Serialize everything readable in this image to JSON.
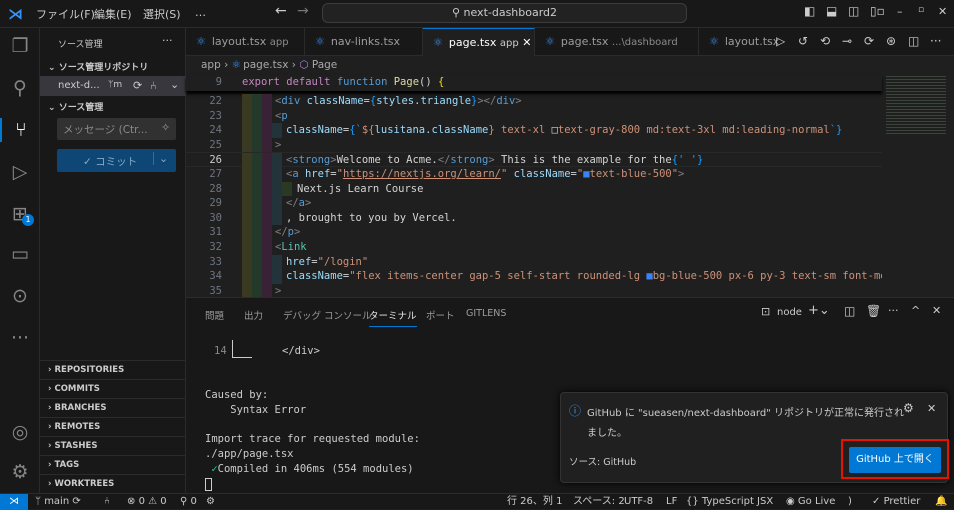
{
  "titlebar": {
    "menus": [
      "ファイル(F)",
      "編集(E)",
      "選択(S)",
      "…"
    ],
    "search": "next-dashboard2"
  },
  "activity": {
    "extensions_badge": "1"
  },
  "sidebar": {
    "title": "ソース管理",
    "repos_header": "ソース管理リポジトリ",
    "repo_name": "next-d...",
    "repo_branch_icon": "ᛘm",
    "sc_header": "ソース管理",
    "message_placeholder": "メッセージ (Ctr...",
    "commit_label": "✓ コミット",
    "sections": [
      "REPOSITORIES",
      "COMMITS",
      "BRANCHES",
      "REMOTES",
      "STASHES",
      "TAGS",
      "WORKTREES"
    ]
  },
  "tabs": [
    {
      "name": "layout.tsx",
      "desc": "app"
    },
    {
      "name": "nav-links.tsx",
      "desc": ""
    },
    {
      "name": "page.tsx",
      "desc": "app",
      "active": true
    },
    {
      "name": "page.tsx",
      "desc": "...\\dashboard"
    },
    {
      "name": "layout.tsx",
      "desc": ""
    }
  ],
  "breadcrumb": [
    "app",
    "page.tsx",
    "Page"
  ],
  "sticky": {
    "num": "9",
    "tokens": [
      [
        "export default ",
        "k"
      ],
      [
        "function ",
        "f"
      ],
      [
        "Page",
        "y"
      ],
      [
        "() ",
        "w"
      ],
      [
        "{",
        "b"
      ]
    ]
  },
  "code": [
    {
      "num": "22",
      "indent": 3,
      "tokens": [
        [
          "<",
          "g"
        ],
        [
          "div ",
          "t"
        ],
        [
          "className",
          "a"
        ],
        [
          "=",
          "w"
        ],
        [
          "{",
          "p"
        ],
        [
          "styles.triangle",
          "v"
        ],
        [
          "}",
          "p"
        ],
        [
          "></",
          "g"
        ],
        [
          "div",
          "t"
        ],
        [
          ">",
          "g"
        ]
      ]
    },
    {
      "num": "23",
      "indent": 3,
      "tokens": [
        [
          "<",
          "g"
        ],
        [
          "p",
          "t"
        ]
      ]
    },
    {
      "num": "24",
      "indent": 4,
      "tokens": [
        [
          "className",
          "a"
        ],
        [
          "=",
          "w"
        ],
        [
          "{`",
          "p"
        ],
        [
          "${",
          "s"
        ],
        [
          "lusitana.className",
          "v"
        ],
        [
          "}",
          "s"
        ],
        [
          " text-xl ",
          "s"
        ],
        [
          "□",
          "w"
        ],
        [
          "text-gray-800 md:text-3xl md:leading-normal",
          "s"
        ],
        [
          "`}",
          "p"
        ]
      ]
    },
    {
      "num": "25",
      "indent": 3,
      "tokens": [
        [
          ">",
          "g"
        ]
      ]
    },
    {
      "num": "26",
      "indent": 4,
      "tokens": [
        [
          "<",
          "g"
        ],
        [
          "strong",
          "t"
        ],
        [
          ">",
          "g"
        ],
        [
          "Welcome to Acme.",
          "w"
        ],
        [
          "</",
          "g"
        ],
        [
          "strong",
          "t"
        ],
        [
          ">",
          "g"
        ],
        [
          " This is the example for the",
          "w"
        ],
        [
          "{' '}",
          "p"
        ]
      ]
    },
    {
      "num": "27",
      "indent": 4,
      "tokens": [
        [
          "<",
          "g"
        ],
        [
          "a ",
          "t"
        ],
        [
          "href",
          "a"
        ],
        [
          "=",
          "w"
        ],
        [
          "\"",
          "s"
        ],
        [
          "https://nextjs.org/learn/",
          "u"
        ],
        [
          "\" ",
          "s"
        ],
        [
          "className",
          "a"
        ],
        [
          "=",
          "w"
        ],
        [
          "\"",
          "s"
        ],
        [
          "■",
          "blue"
        ],
        [
          "text-blue-500\"",
          "s"
        ],
        [
          ">",
          "g"
        ]
      ]
    },
    {
      "num": "28",
      "indent": 5,
      "tokens": [
        [
          "Next.js Learn Course",
          "w"
        ]
      ]
    },
    {
      "num": "29",
      "indent": 4,
      "tokens": [
        [
          "</",
          "g"
        ],
        [
          "a",
          "t"
        ],
        [
          ">",
          "g"
        ]
      ]
    },
    {
      "num": "30",
      "indent": 4,
      "tokens": [
        [
          ", brought to you by Vercel.",
          "w"
        ]
      ]
    },
    {
      "num": "31",
      "indent": 3,
      "tokens": [
        [
          "</",
          "g"
        ],
        [
          "p",
          "t"
        ],
        [
          ">",
          "g"
        ]
      ]
    },
    {
      "num": "32",
      "indent": 3,
      "tokens": [
        [
          "<",
          "g"
        ],
        [
          "Link",
          "c"
        ]
      ]
    },
    {
      "num": "33",
      "indent": 4,
      "tokens": [
        [
          "href",
          "a"
        ],
        [
          "=",
          "w"
        ],
        [
          "\"/login\"",
          "s"
        ]
      ]
    },
    {
      "num": "34",
      "indent": 4,
      "tokens": [
        [
          "className",
          "a"
        ],
        [
          "=",
          "w"
        ],
        [
          "\"flex items-center gap-5 self-start rounded-lg ",
          "s"
        ],
        [
          "■",
          "blue"
        ],
        [
          "bg-blue-500 px-6 py-3 text-sm font-me",
          "s"
        ]
      ]
    },
    {
      "num": "35",
      "indent": 3,
      "tokens": [
        [
          ">",
          "g"
        ]
      ]
    }
  ],
  "panel": {
    "tabs": [
      "問題",
      "出力",
      "デバッグ コンソール",
      "ターミナル",
      "ポート",
      "GITLENS"
    ],
    "active_tab": "ターミナル",
    "shell": "node",
    "terminal_lines": [
      {
        "num": "14",
        "text": "</div>"
      },
      "",
      "Caused by:",
      "    Syntax Error",
      "",
      "Import trace for requested module:",
      "./app/page.tsx",
      {
        "check": "✓",
        "text": "Compiled in 406ms (554 modules)"
      }
    ]
  },
  "notification": {
    "message_line1": "GitHub に \"sueasen/next-dashboard\" リポジトリが正常に発行され",
    "message_line2": "ました。",
    "source": "ソース: GitHub",
    "button": "GitHub 上で開く"
  },
  "status": {
    "branch": "main",
    "errors": "0",
    "warnings": "0",
    "ports": "0",
    "position": "行 26、列 1",
    "spaces": "スペース: 2",
    "encoding": "UTF-8",
    "eol": "LF",
    "language": "TypeScript JSX",
    "golive": "Go Live",
    "prettier": "Prettier"
  },
  "colors": {
    "accent": "#0078d4",
    "highlight": "#e51400",
    "status_remote": "#0078d4"
  }
}
